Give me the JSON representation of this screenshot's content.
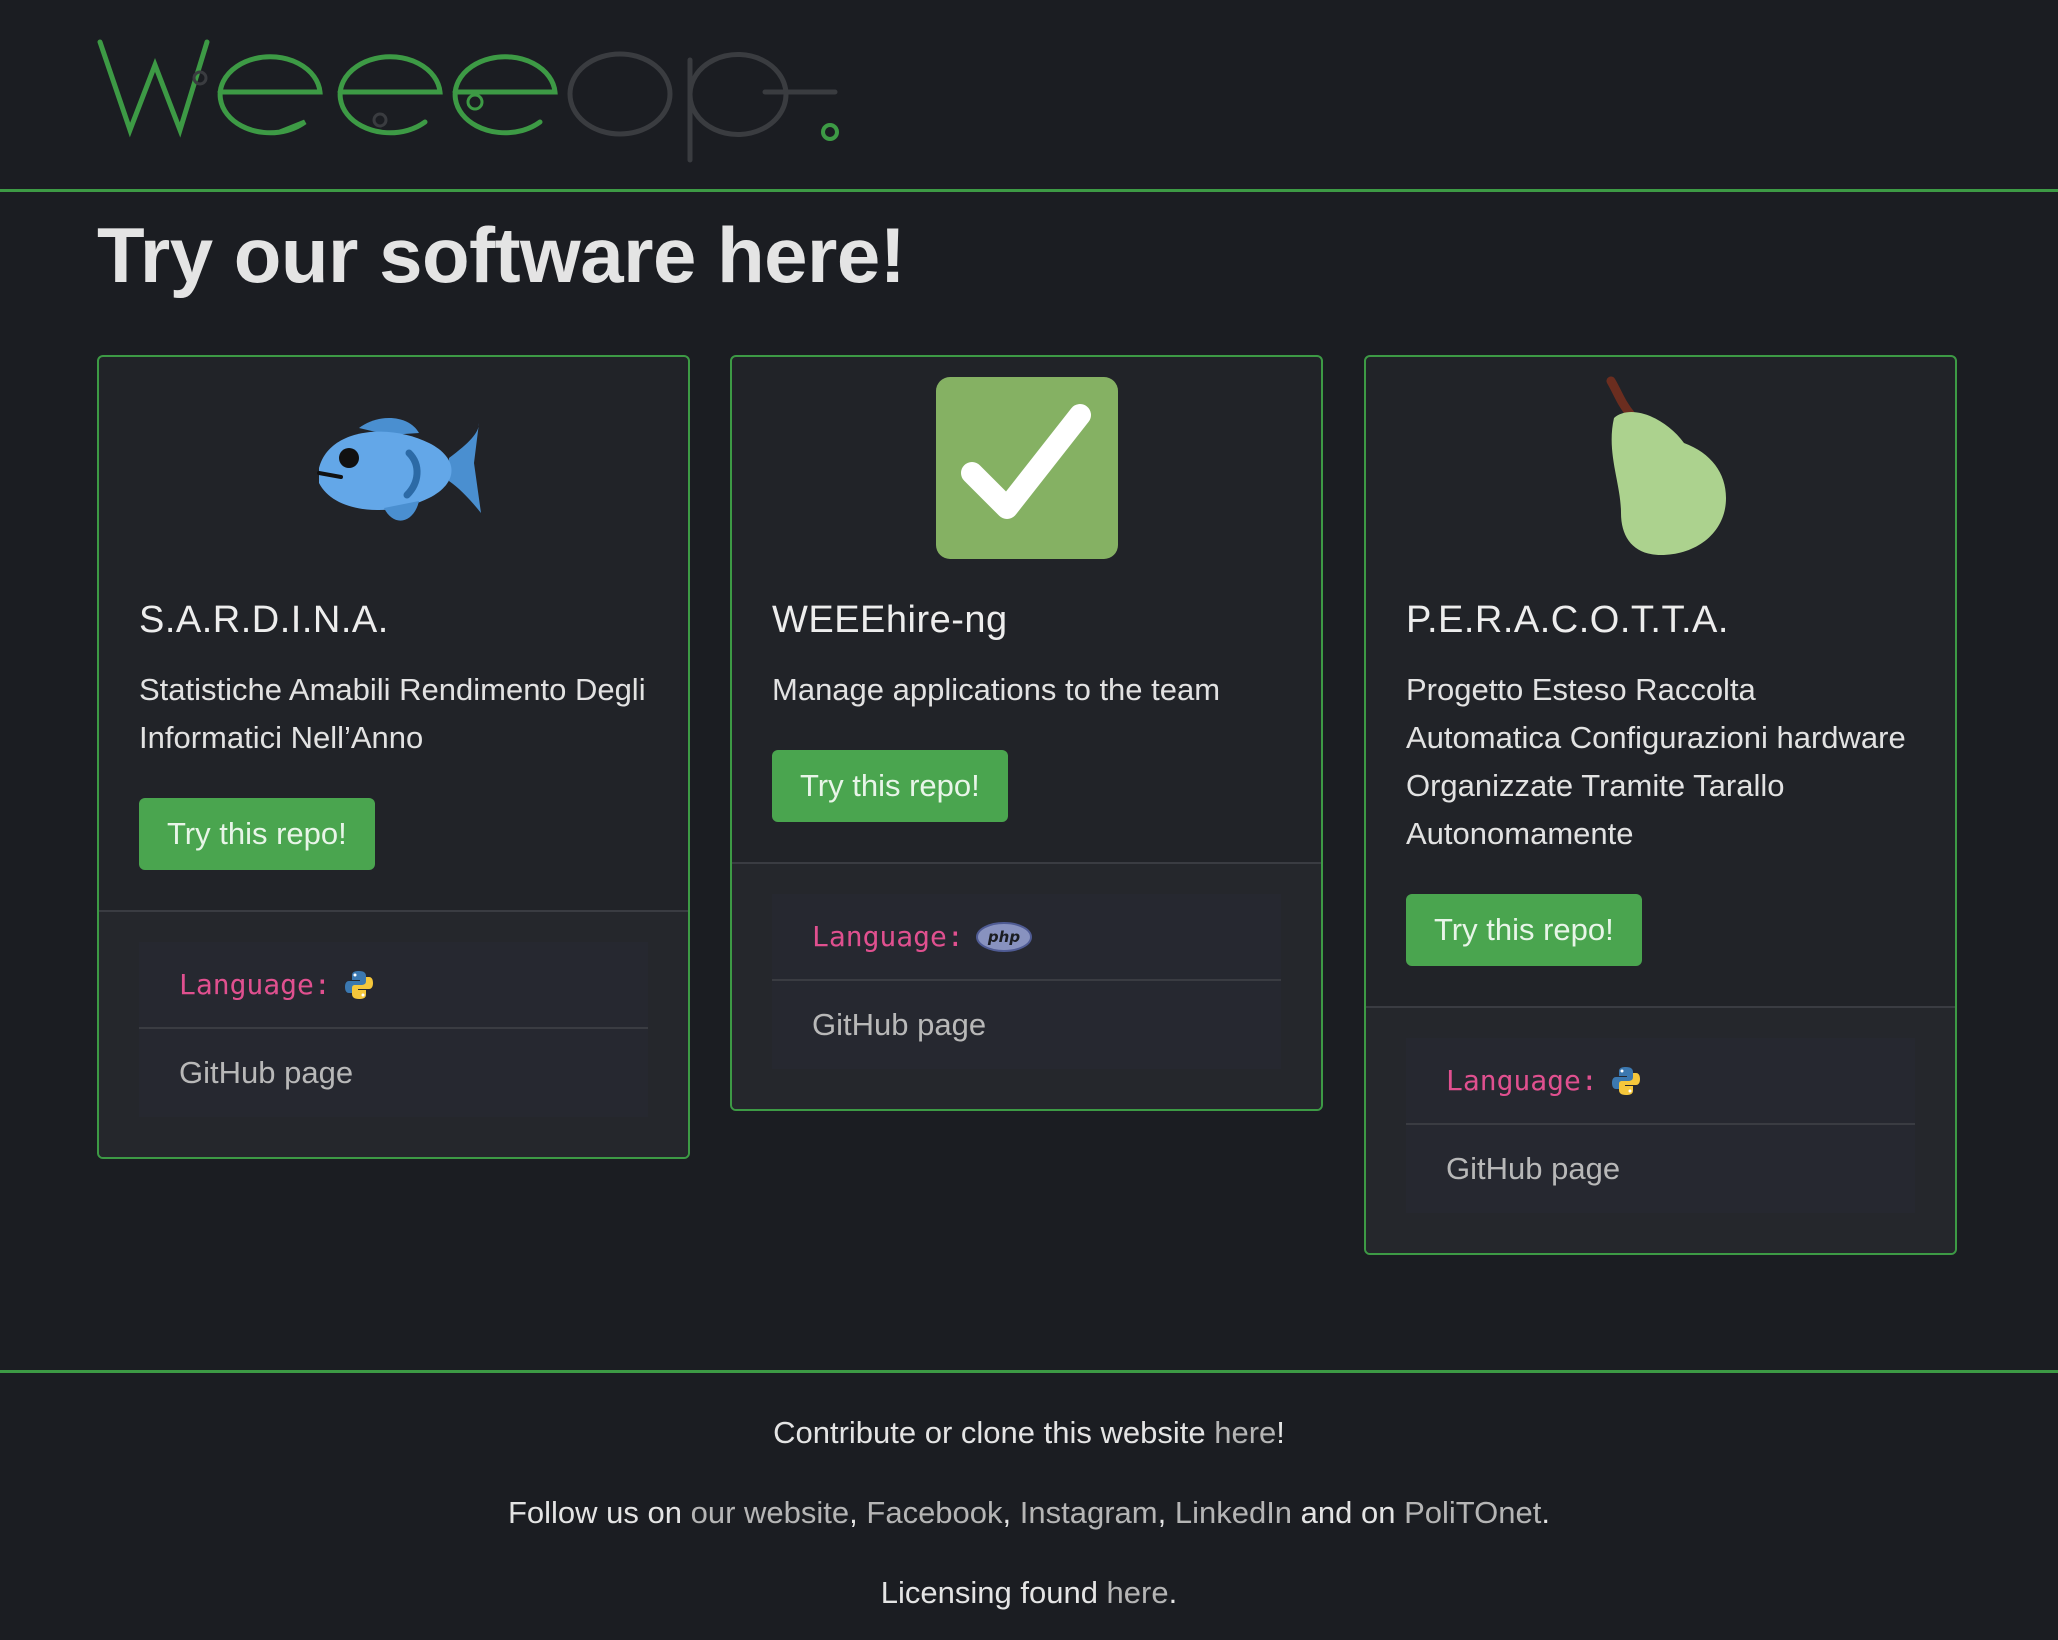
{
  "header": {
    "logo_text": "weeeopen",
    "colors": {
      "green": "#3d9a45",
      "dark": "#3a3c40"
    }
  },
  "page_title": "Try our software here!",
  "cards": [
    {
      "icon": "fish-icon",
      "title": "S.A.R.D.I.N.A.",
      "description": "Statistiche Amabili Rendimento Degli Informatici Nell’Anno",
      "button_label": "Try this repo!",
      "language_label": "Language:",
      "language_icon": "python-icon",
      "github_label": "GitHub page"
    },
    {
      "icon": "check-mark-icon",
      "title": "WEEEhire-ng",
      "description": "Manage applications to the team",
      "button_label": "Try this repo!",
      "language_label": "Language:",
      "language_icon": "php-icon",
      "language_icon_text": "php",
      "github_label": "GitHub page"
    },
    {
      "icon": "pear-icon",
      "title": "P.E.R.A.C.O.T.T.A.",
      "description": "Progetto Esteso Raccolta Automatica Configurazioni hardware Organizzate Tramite Tarallo Autonomamente",
      "button_label": "Try this repo!",
      "language_label": "Language:",
      "language_icon": "python-icon",
      "github_label": "GitHub page"
    }
  ],
  "footer": {
    "line1_prefix": "Contribute or clone this website ",
    "line1_link": "here",
    "line1_suffix": "!",
    "line2_prefix": "Follow us on ",
    "line2_links": [
      "our website",
      "Facebook",
      "Instagram",
      "LinkedIn",
      "PoliTOnet"
    ],
    "line2_sep": ", ",
    "line2_and": " and on ",
    "line2_suffix": ".",
    "line3_prefix": "Licensing found ",
    "line3_link": "here",
    "line3_suffix": "."
  },
  "colors": {
    "background": "#1b1d22",
    "card_bg": "#212328",
    "accent_green": "#3d9a45",
    "button_green": "#4aa54f",
    "language_pink": "#e0508f"
  }
}
